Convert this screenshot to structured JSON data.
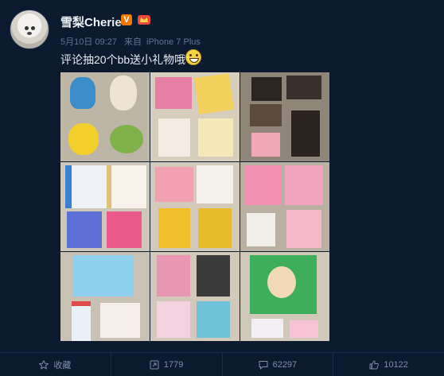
{
  "post": {
    "username": "雪梨Cherie",
    "verified_badge": "V",
    "date": "5月10日 09:27",
    "source_prefix": "来自",
    "source": "iPhone 7 Plus",
    "text": "评论抽20个bb送小礼物哦"
  },
  "images": [
    {
      "label": "plush-toys-monsters"
    },
    {
      "label": "beauty-masks-pack"
    },
    {
      "label": "eyeshadow-palettes"
    },
    {
      "label": "sunscreen-bottles"
    },
    {
      "label": "face-masks-set"
    },
    {
      "label": "hair-color-boxes"
    },
    {
      "label": "cleansing-bottles"
    },
    {
      "label": "eyeliner-mascara"
    },
    {
      "label": "foot-patch-sheets"
    }
  ],
  "actions": {
    "favorite": "收藏",
    "repost": "1779",
    "comment": "62297",
    "like": "10122"
  },
  "colors": {
    "background": "#0b1a2f",
    "text_muted": "#5f7490",
    "badge_orange": "#f07a00"
  }
}
